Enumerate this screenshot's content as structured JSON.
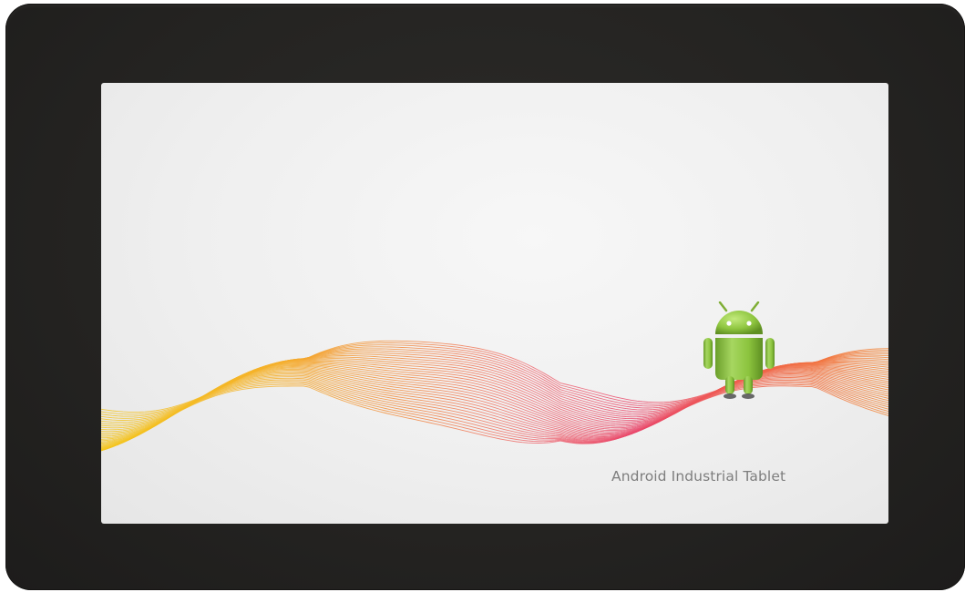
{
  "device": {
    "type": "tablet",
    "bezel_color": "#242321"
  },
  "wallpaper": {
    "caption": "Android Industrial Tablet",
    "background_color": "#efefef",
    "wave_colors": [
      "#f2c21d",
      "#f39a3a",
      "#ec5470",
      "#f06a4a",
      "#f38a3a"
    ],
    "mascot": "android-robot-icon",
    "mascot_color": "#8ec63f"
  }
}
